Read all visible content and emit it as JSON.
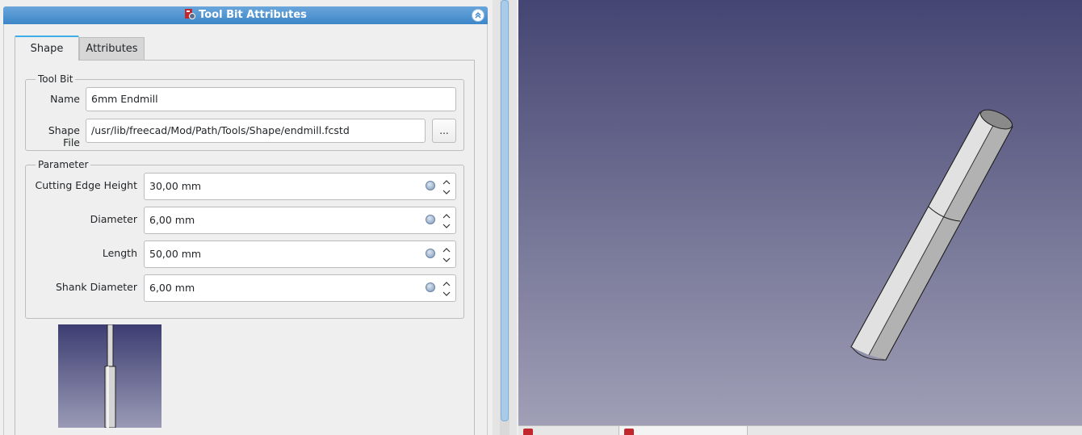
{
  "panel": {
    "title": "Tool Bit Attributes",
    "tabs": [
      {
        "label": "Shape"
      },
      {
        "label": "Attributes"
      }
    ],
    "toolbit_group": {
      "title": "Tool Bit",
      "name_label": "Name",
      "name_value": "6mm Endmill",
      "shape_file_label": "Shape File",
      "shape_file_value": "/usr/lib/freecad/Mod/Path/Tools/Shape/endmill.fcstd",
      "browse_label": "..."
    },
    "parameter_group": {
      "title": "Parameter",
      "fields": [
        {
          "label": "Cutting  Edge  Height",
          "value": "30,00 mm"
        },
        {
          "label": "Diameter",
          "value": "6,00 mm"
        },
        {
          "label": "Length",
          "value": "50,00 mm"
        },
        {
          "label": "Shank  Diameter",
          "value": "6,00 mm"
        }
      ]
    },
    "icons": {
      "title": "freecad-path-icon",
      "collapse": "chevron-double-up-icon",
      "expression": "expression-icon",
      "spin": "spin-arrows-icon"
    }
  },
  "colors": {
    "accent": "#3daee9",
    "titlebar": "#4a90d0",
    "view_top": "#454573",
    "view_bottom": "#9f9fb6",
    "model_fill": "#c8c8c8"
  }
}
